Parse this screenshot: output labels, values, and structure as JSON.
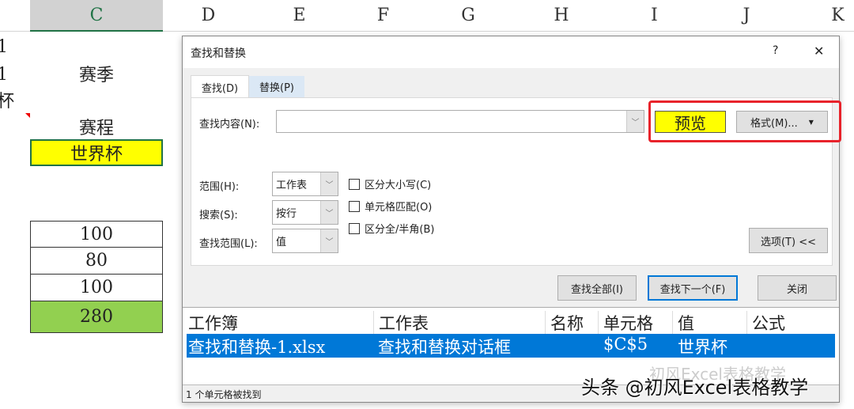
{
  "sheet": {
    "columns": [
      "C",
      "D",
      "E",
      "F",
      "G",
      "H",
      "I",
      "J",
      "K"
    ],
    "left_cut_cells": [
      "1",
      "1",
      "杯"
    ],
    "cells": {
      "season": "赛季",
      "schedule": "赛程",
      "world_cup": "世界杯"
    },
    "scores": [
      "100",
      "80",
      "100",
      "280"
    ],
    "colors": {
      "highlight_yellow": "#ffff00",
      "total_green": "#92d050"
    }
  },
  "dialog": {
    "title": "查找和替换",
    "help": "?",
    "close": "✕",
    "tabs": [
      "查找(D)",
      "替换(P)"
    ],
    "find_label": "查找内容(N):",
    "find_value": "",
    "preview": "预览",
    "format_button": "格式(M)...",
    "options": [
      {
        "label": "范围(H):",
        "value": "工作表"
      },
      {
        "label": "搜索(S):",
        "value": "按行"
      },
      {
        "label": "查找范围(L):",
        "value": "值"
      }
    ],
    "checkboxes": [
      "区分大小写(C)",
      "单元格匹配(O)",
      "区分全/半角(B)"
    ],
    "options_button": "选项(T) <<",
    "find_all": "查找全部(I)",
    "find_next": "查找下一个(F)",
    "close_button": "关闭",
    "results": {
      "headers": [
        "工作簿",
        "工作表",
        "名称",
        "单元格",
        "值",
        "公式"
      ],
      "rows": [
        [
          "查找和替换-1.xlsx",
          "查找和替换对话框",
          "",
          "$C$5",
          "世界杯",
          ""
        ]
      ]
    },
    "status": "1 个单元格被找到"
  },
  "watermark": {
    "faint": "初风Excel表格教学",
    "main": "头条 @初风Excel表格教学"
  }
}
